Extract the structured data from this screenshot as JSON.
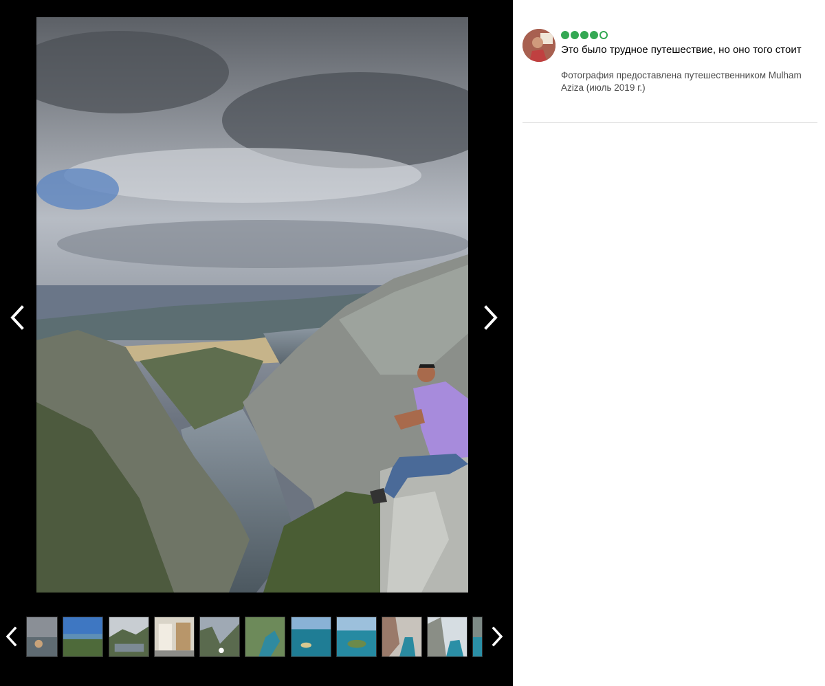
{
  "viewer": {
    "main_photo_alt": "",
    "prev_icon": "chevron-left-icon",
    "next_icon": "chevron-right-icon"
  },
  "thumbnails": [
    {
      "name": "thumb-1"
    },
    {
      "name": "thumb-2"
    },
    {
      "name": "thumb-3"
    },
    {
      "name": "thumb-4"
    },
    {
      "name": "thumb-5"
    },
    {
      "name": "thumb-6"
    },
    {
      "name": "thumb-7"
    },
    {
      "name": "thumb-8"
    },
    {
      "name": "thumb-9"
    },
    {
      "name": "thumb-10"
    },
    {
      "name": "thumb-11"
    }
  ],
  "review": {
    "rating": 4,
    "rating_max": 5,
    "rating_color": "#34a853",
    "title": "Это было трудное путешествие, но оно того стоит",
    "caption": "Фотография предоставлена путешественником Mulham Aziza (июль 2019 г.)"
  }
}
